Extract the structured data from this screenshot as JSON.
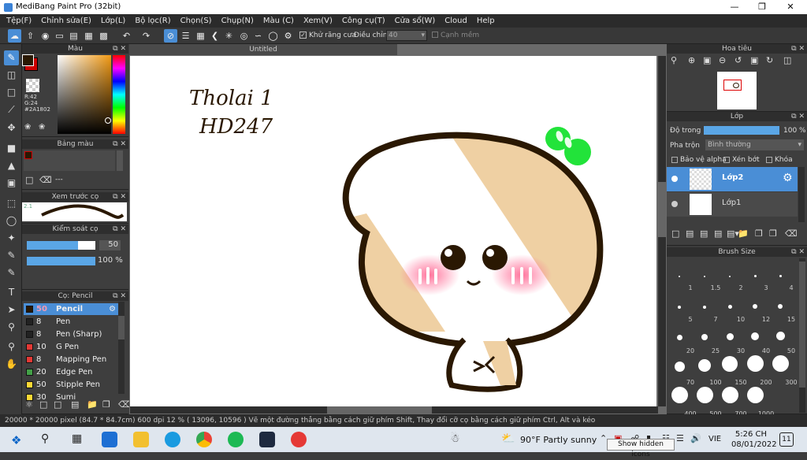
{
  "window": {
    "title": "MediBang Paint Pro (32bit)"
  },
  "menu": [
    "Tệp(F)",
    "Chỉnh sửa(E)",
    "Lớp(L)",
    "Bộ lọc(R)",
    "Chọn(S)",
    "Chụp(N)",
    "Màu (C)",
    "Xem(V)",
    "Công cụ(T)",
    "Cửa sổ(W)",
    "Cloud",
    "Help"
  ],
  "toolbar": {
    "antialias": "Khử răng cưa",
    "adjust": "Điều chỉnh",
    "adjust_value": "40",
    "edge": "Cạnh mềm"
  },
  "color_panel": {
    "title": "Màu",
    "r": "R:42",
    "g": "G:24",
    "hex": "#2A1802",
    "color": "#2A1802"
  },
  "palette_panel": {
    "title": "Bảng màu",
    "dots": "---"
  },
  "brush_preview": {
    "title": "Xem trước cọ",
    "size": "2.1"
  },
  "brush_control": {
    "title": "Kiểm soát cọ",
    "size": "50",
    "opacity": "100 %"
  },
  "brush_list": {
    "title": "Cọ: Pencil",
    "items": [
      {
        "size": "50",
        "name": "Pencil",
        "color": "#2A1802"
      },
      {
        "size": "8",
        "name": "Pen",
        "color": "#222222"
      },
      {
        "size": "8",
        "name": "Pen (Sharp)",
        "color": "#222222"
      },
      {
        "size": "10",
        "name": "G Pen",
        "color": "#e53935"
      },
      {
        "size": "8",
        "name": "Mapping Pen",
        "color": "#e53935"
      },
      {
        "size": "20",
        "name": "Edge Pen",
        "color": "#43a047"
      },
      {
        "size": "50",
        "name": "Stipple Pen",
        "color": "#fdd835"
      },
      {
        "size": "30",
        "name": "Sumi",
        "color": "#fdd835"
      }
    ]
  },
  "canvas": {
    "title": "Untitled",
    "handwriting_line1": "Tholai 1",
    "handwriting_line2": "HD247"
  },
  "navigator": {
    "title": "Hoa tiêu"
  },
  "layer_panel": {
    "title": "Lớp",
    "opacity_label": "Độ trong",
    "opacity_value": "100 %",
    "opacity_fraction": 1.0,
    "blend_label": "Pha trộn",
    "blend_value": "Bình thường",
    "protect_alpha": "Bảo vệ alpha",
    "clip": "Xén bớt",
    "lock": "Khóa",
    "layers": [
      "Lớp2",
      "Lớp1"
    ]
  },
  "brush_size_panel": {
    "title": "Brush Size",
    "sizes": [
      "1",
      "1.5",
      "2",
      "3",
      "4",
      "5",
      "7",
      "10",
      "12",
      "15",
      "20",
      "25",
      "30",
      "40",
      "50",
      "70",
      "100",
      "150",
      "200",
      "300",
      "400",
      "500",
      "700",
      "1000"
    ]
  },
  "status": {
    "text": "20000 * 20000 pixel  (84.7 * 84.7cm)  600 dpi   12 %  ( 13096, 10596 )   Vẽ một đường thẳng bằng cách giữ phím Shift, Thay đổi cỡ cọ bằng cách giữ phím Ctrl, Alt và kéo"
  },
  "taskbar": {
    "weather": "90°F  Partly sunny",
    "lang": "VIE",
    "time": "5:26 CH",
    "date": "08/01/2022",
    "tooltip": "Show hidden icons",
    "notif": "11"
  }
}
